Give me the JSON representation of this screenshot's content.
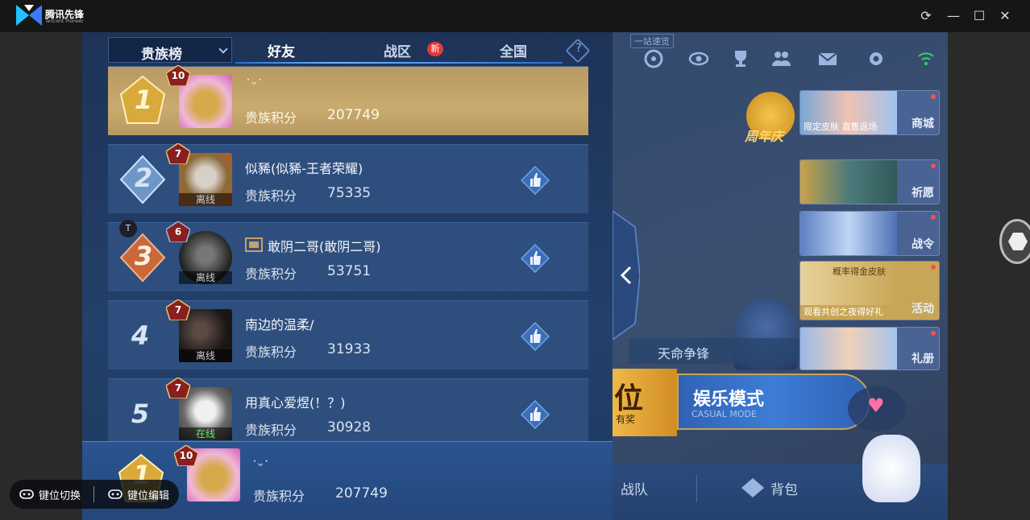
{
  "window": {
    "app_name": "腾讯先锋",
    "app_subtitle": "Tencent Pioneer",
    "controls": [
      "refresh-icon",
      "minimize-icon",
      "maximize-icon",
      "close-icon"
    ]
  },
  "leaderboard": {
    "dropdown_label": "贵族榜",
    "tabs": [
      {
        "label": "好友",
        "active": true
      },
      {
        "label": "战区",
        "badge": "新"
      },
      {
        "label": "全国"
      }
    ],
    "rows": [
      {
        "rank": "1",
        "level": "10",
        "name": "˙ᵕ˙",
        "score_label": "贵族积分",
        "score": "207749",
        "status": "",
        "self": true
      },
      {
        "rank": "2",
        "level": "7",
        "name": "似豨(似豨-王者荣耀)",
        "score_label": "贵族积分",
        "score": "75335",
        "status": "离线"
      },
      {
        "rank": "3",
        "level": "6",
        "name": "敢阴二哥(敢阴二哥)",
        "score_label": "贵族积分",
        "score": "53751",
        "status": "离线",
        "tag": "T"
      },
      {
        "rank": "4",
        "level": "7",
        "name": "南边的温柔/",
        "score_label": "贵族积分",
        "score": "31933",
        "status": "离线"
      },
      {
        "rank": "5",
        "level": "7",
        "name": "用真心爱煜(！？)",
        "score_label": "贵族积分",
        "score": "30928",
        "status": "在线"
      }
    ],
    "self_row": {
      "rank": "1",
      "level": "10",
      "name": "˙ᵕ˙",
      "score_label": "贵族积分",
      "score": "207749"
    }
  },
  "game_panel": {
    "top_badge": "一站速览",
    "anniversary": "周年庆",
    "cards": [
      {
        "label": "商城",
        "sub": "限定皮肤 直售返场"
      },
      {
        "label": "祈愿",
        "sub": ""
      },
      {
        "label": "战令",
        "sub": ""
      },
      {
        "label": "活动",
        "sub": "观看共创之夜得好礼",
        "header": "概率得金皮肤"
      },
      {
        "label": "礼册",
        "sub": ""
      }
    ],
    "mode_banner": "天命争锋",
    "rank_mode_partial": "位",
    "rank_mode_sub": "有奖",
    "casual_mode": "娱乐模式",
    "casual_mode_en": "CASUAL MODE",
    "bottom_nav": [
      "战队",
      "背包"
    ]
  },
  "key_pill": {
    "switch_label": "键位切换",
    "edit_label": "键位编辑"
  }
}
